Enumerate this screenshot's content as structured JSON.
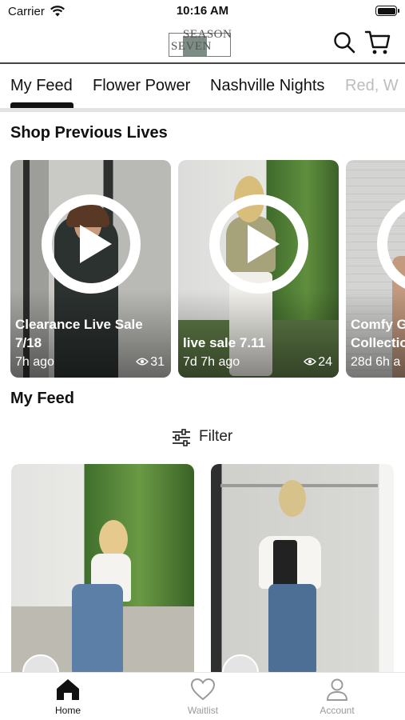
{
  "status_bar": {
    "carrier": "Carrier",
    "time": "10:16 AM"
  },
  "header": {
    "logo_line1": "SEASON",
    "logo_line2": "SEVEN",
    "icons": [
      "search-icon",
      "cart-icon"
    ]
  },
  "tabs": [
    {
      "label": "My Feed",
      "active": true
    },
    {
      "label": "Flower Power",
      "active": false
    },
    {
      "label": "Nashville Nights",
      "active": false
    },
    {
      "label": "Red, W",
      "active": false
    }
  ],
  "previous_lives": {
    "title": "Shop Previous Lives",
    "items": [
      {
        "title_line1": "Clearance Live Sale",
        "title_line2": "7/18",
        "ago": "7h ago",
        "views": "31"
      },
      {
        "title_line1": "live sale 7.11",
        "title_line2": "",
        "ago": "7d 7h ago",
        "views": "24"
      },
      {
        "title_line1": "Comfy G",
        "title_line2": "Collectio",
        "ago": "28d 6h a",
        "views": ""
      }
    ]
  },
  "feed": {
    "title": "My Feed",
    "filter_label": "Filter"
  },
  "tab_bar": {
    "items": [
      {
        "label": "Home",
        "icon": "home-icon",
        "active": true
      },
      {
        "label": "Waitlist",
        "icon": "heart-icon",
        "active": false
      },
      {
        "label": "Account",
        "icon": "person-icon",
        "active": false
      }
    ]
  },
  "colors": {
    "text": "#111111",
    "inactive": "#9a9a9a",
    "faded_tab": "#bdbdbd",
    "divider": "#e3e3e3"
  }
}
